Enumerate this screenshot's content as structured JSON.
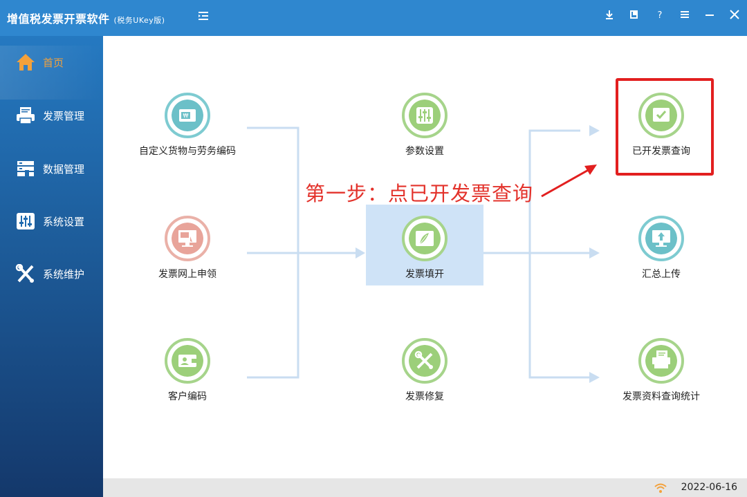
{
  "app": {
    "title": "增值税发票开票软件",
    "edition": "(税务UKey版)"
  },
  "window_controls": [
    "download-icon",
    "restore-icon",
    "help-icon",
    "menu-icon",
    "minimize-icon",
    "close-icon"
  ],
  "sidebar": {
    "items": [
      {
        "label": "首页",
        "icon": "home-icon",
        "active": true
      },
      {
        "label": "发票管理",
        "icon": "printer-icon"
      },
      {
        "label": "数据管理",
        "icon": "data-icon"
      },
      {
        "label": "系统设置",
        "icon": "sliders-icon"
      },
      {
        "label": "系统维护",
        "icon": "tools-icon"
      }
    ]
  },
  "modules": {
    "custom_goods": {
      "label": "自定义货物与劳务编码",
      "icon": "goods-card-icon"
    },
    "online_apply": {
      "label": "发票网上申领",
      "icon": "monitor-hand-icon"
    },
    "customer_code": {
      "label": "客户编码",
      "icon": "wallet-icon"
    },
    "params": {
      "label": "参数设置",
      "icon": "sliders-icon"
    },
    "invoice_fill": {
      "label": "发票填开",
      "icon": "feather-icon"
    },
    "invoice_repair": {
      "label": "发票修复",
      "icon": "wrench-icon"
    },
    "issued_query": {
      "label": "已开发票查询",
      "icon": "search-check-icon"
    },
    "summary_upload": {
      "label": "汇总上传",
      "icon": "upload-monitor-icon"
    },
    "stats_query": {
      "label": "发票资料查询统计",
      "icon": "documents-search-icon"
    }
  },
  "annotation": "第一步：点已开发票查询",
  "status": {
    "date": "2022-06-16"
  },
  "colors": {
    "titlebar": "#2f87cf",
    "teal": "#6cc0c8",
    "salmon": "#e8a49a",
    "green": "#9ccf7a",
    "accent_active": "#f3a13b",
    "annotation_red": "#e3322b"
  }
}
